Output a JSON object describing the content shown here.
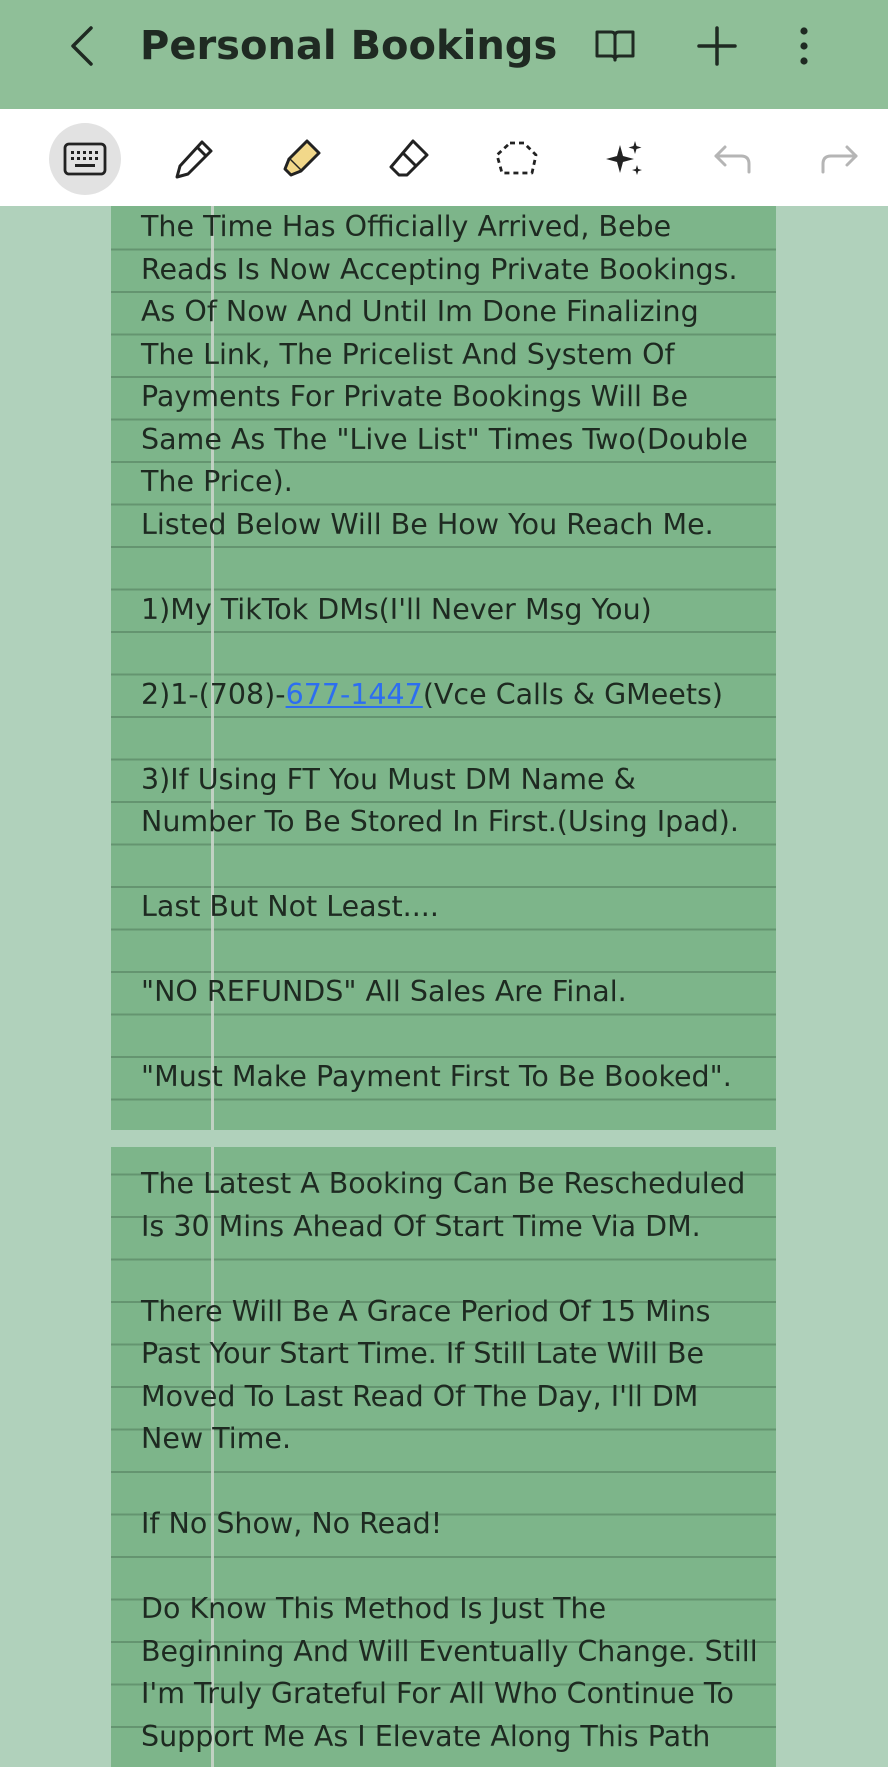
{
  "header": {
    "title": "Personal Bookings",
    "back_icon": "chevron-left-icon",
    "icons": [
      "book-icon",
      "plus-icon",
      "more-vertical-icon"
    ]
  },
  "toolbar": {
    "tools": [
      "keyboard-icon",
      "pen-icon",
      "highlighter-icon",
      "eraser-icon",
      "lasso-icon",
      "sparkle-icon",
      "undo-icon",
      "redo-icon"
    ],
    "active": "keyboard-icon"
  },
  "note1": {
    "lines": [
      "The Time Has Officially Arrived, Bebe",
      "Reads Is Now Accepting Private Bookings.",
      "As Of Now And Until Im Done Finalizing",
      "The Link, The Pricelist And System Of",
      "Payments For Private Bookings Will Be",
      "Same As The \"Live List\" Times Two(Double",
      "The Price).",
      "Listed Below Will Be How You Reach Me.",
      "",
      "1)My TikTok DMs(I'll Never Msg You)",
      "",
      "",
      "",
      "3)If Using FT You Must DM Name &",
      "Number To Be Stored In First.(Using Ipad).",
      "",
      "Last But Not Least....",
      "",
      "\"NO REFUNDS\" All Sales Are Final.",
      "",
      "\"Must Make Payment First To Be Booked\"."
    ],
    "phone_prefix": "2)1-(708)-",
    "phone_link": "677-1447",
    "phone_suffix": "(Vce Calls & GMeets)"
  },
  "note2": {
    "lines": [
      "The Latest A Booking Can Be Rescheduled",
      "Is 30 Mins Ahead Of Start Time Via DM.",
      "",
      "There Will Be A Grace Period Of 15 Mins",
      "Past Your Start Time. If Still Late Will Be",
      "Moved To Last Read Of The Day, I'll DM",
      "New Time.",
      "",
      "If No Show, No Read!",
      "",
      "Do Know This Method Is Just The",
      "Beginning And Will Eventually Change. Still",
      "I'm Truly Grateful For All Who Continue To",
      "Support Me As I Elevate Along This Path"
    ]
  }
}
